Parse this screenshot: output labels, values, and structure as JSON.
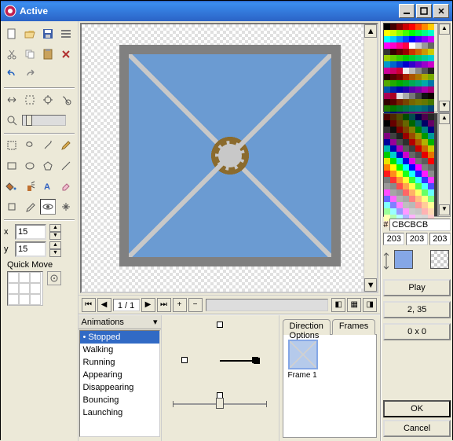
{
  "titlebar": {
    "title": "Active"
  },
  "canvas": {
    "frame_counter": "1 / 1"
  },
  "coords": {
    "x_label": "x",
    "x_value": "15",
    "y_label": "y",
    "y_value": "15"
  },
  "quickmove": {
    "label": "Quick Move"
  },
  "animations": {
    "heading": "Animations",
    "items": [
      "Stopped",
      "Walking",
      "Running",
      "Appearing",
      "Disappearing",
      "Bouncing",
      "Launching"
    ],
    "selected_index": 0
  },
  "tabs": {
    "direction_label": "Direction Options",
    "frames_label": "Frames",
    "frame1_label": "Frame 1"
  },
  "color": {
    "hash": "#",
    "hex": "CBCBCB",
    "r": "203",
    "g": "203",
    "b": "203"
  },
  "buttons": {
    "play": "Play",
    "coords": "2, 35",
    "size": "0 x 0",
    "ok": "OK",
    "cancel": "Cancel"
  },
  "palette_colors": [
    "#000",
    "#400",
    "#800",
    "#c00",
    "#f00",
    "#f40",
    "#f80",
    "#fc0",
    "#ff0",
    "#cf0",
    "#8f0",
    "#4f0",
    "#0f0",
    "#0f4",
    "#0f8",
    "#0fc",
    "#0ff",
    "#0cf",
    "#08f",
    "#04f",
    "#00f",
    "#40f",
    "#80f",
    "#c0f",
    "#f0f",
    "#f0c",
    "#f08",
    "#f04",
    "#fff",
    "#ccc",
    "#999",
    "#666",
    "#333",
    "#300",
    "#600",
    "#900",
    "#c30",
    "#c60",
    "#c90",
    "#cc0",
    "#9c0",
    "#6c0",
    "#3c0",
    "#0c0",
    "#0c3",
    "#0c6",
    "#0c9",
    "#0cc",
    "#09c",
    "#06c",
    "#03c",
    "#00c",
    "#30c",
    "#60c",
    "#90c",
    "#c0c",
    "#c09",
    "#c06",
    "#c03",
    "#eee",
    "#bbb",
    "#888",
    "#555",
    "#222",
    "#200",
    "#500",
    "#700",
    "#a20",
    "#a50",
    "#a70",
    "#aa0",
    "#7a0",
    "#5a0",
    "#2a0",
    "#0a0",
    "#0a2",
    "#0a5",
    "#0a7",
    "#0aa",
    "#07a",
    "#05a",
    "#02a",
    "#00a",
    "#20a",
    "#50a",
    "#70a",
    "#a0a",
    "#a07",
    "#a05",
    "#a02",
    "#ddd",
    "#aaa",
    "#777",
    "#444",
    "#111",
    "#100",
    "#300",
    "#500",
    "#720",
    "#740",
    "#760",
    "#770",
    "#670",
    "#470",
    "#270",
    "#070",
    "#072",
    "#074",
    "#076",
    "#077",
    "#067",
    "#047",
    "#027",
    "#007",
    "#207",
    "#407",
    "#607",
    "#707",
    "#706",
    "#704",
    "#702",
    "#ccc",
    "#999"
  ],
  "palette2_base": [
    "#000",
    "#111",
    "#222",
    "#333",
    "#444",
    "#555",
    "#666",
    "#777",
    "#888",
    "#999",
    "#aaa",
    "#bbb",
    "#ccc",
    "#ddd",
    "#eee",
    "#fff"
  ]
}
